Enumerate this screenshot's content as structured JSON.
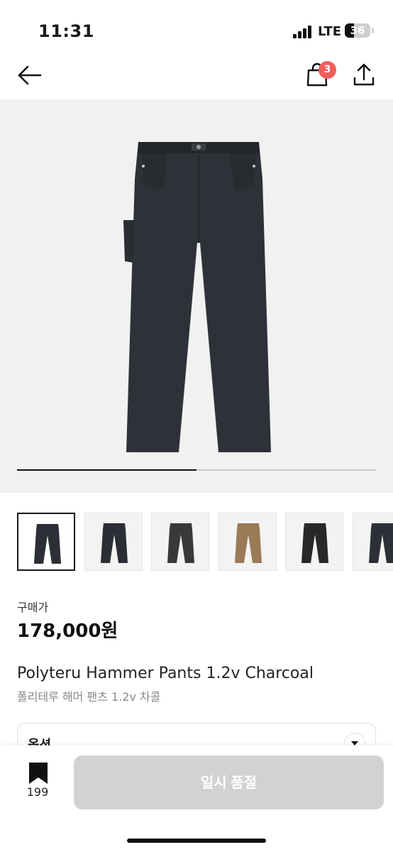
{
  "status_bar": {
    "time": "11:31",
    "network": "LTE",
    "battery": "36"
  },
  "nav": {
    "cart_count": "3"
  },
  "gallery": {
    "progress": 0.5,
    "thumbnails": [
      {
        "color": "#2c3036"
      },
      {
        "color": "#2b2f35"
      },
      {
        "color": "#37393b"
      },
      {
        "color": "#9a7a57"
      },
      {
        "color": "#2a2826"
      },
      {
        "color": "#2c3036"
      }
    ]
  },
  "product": {
    "price_label": "구매가",
    "price": "178,000원",
    "name_en": "Polyteru Hammer Pants 1.2v Charcoal",
    "name_ko": "폴리테루 해머 팬츠 1.2v 차콜"
  },
  "options": {
    "label": "옵션"
  },
  "bottom": {
    "bookmark_count": "199",
    "action_label": "일시 품절"
  },
  "colors": {
    "badge": "#ef5f59",
    "disabled_button": "#d2d2d2"
  }
}
